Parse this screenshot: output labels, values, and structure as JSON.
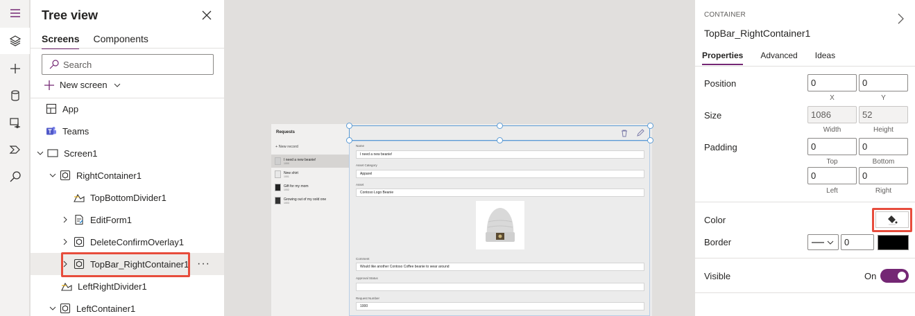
{
  "rail": {
    "items": [
      "hamburger-icon",
      "layers-icon",
      "plus-icon",
      "data-icon",
      "media-icon",
      "power-automate-icon",
      "search-icon"
    ]
  },
  "tree": {
    "title": "Tree view",
    "tabs": [
      {
        "label": "Screens",
        "active": true
      },
      {
        "label": "Components",
        "active": false
      }
    ],
    "search_placeholder": "Search",
    "new_screen": "New screen",
    "items": [
      {
        "label": "App",
        "icon": "app-icon"
      },
      {
        "label": "Teams",
        "icon": "teams-icon"
      },
      {
        "label": "Screen1",
        "icon": "screen-icon",
        "expanded": true
      },
      {
        "label": "RightContainer1",
        "icon": "container-icon",
        "expanded": true
      },
      {
        "label": "TopBottomDivider1",
        "icon": "divider-icon"
      },
      {
        "label": "EditForm1",
        "icon": "form-icon",
        "expanded": false
      },
      {
        "label": "DeleteConfirmOverlay1",
        "icon": "container-icon",
        "expanded": false
      },
      {
        "label": "TopBar_RightContainer1",
        "icon": "container-icon",
        "expanded": false,
        "selected": true
      },
      {
        "label": "LeftRightDivider1",
        "icon": "divider-icon"
      },
      {
        "label": "LeftContainer1",
        "icon": "container-icon",
        "expanded": true
      }
    ],
    "more": "···"
  },
  "app_preview": {
    "left_header": "Requests",
    "new_record": "New record",
    "requests": [
      {
        "title": "I need a new beanie!",
        "num": "1000"
      },
      {
        "title": "New shirt",
        "num": "1001"
      },
      {
        "title": "Gift for my mom",
        "num": "1002"
      },
      {
        "title": "Growing out of my oold one",
        "num": "1003"
      }
    ],
    "fields": [
      {
        "label": "Name",
        "value": "I need a new beanie!"
      },
      {
        "label": "Asset Category",
        "value": "Apparel"
      },
      {
        "label": "Asset",
        "value": "Contoso Logo Beanie"
      },
      {
        "label": "Comment",
        "value": "Would like another Contoso Coffee beanie to wear around"
      },
      {
        "label": "Approval Status",
        "value": ""
      },
      {
        "label": "Request Number",
        "value": "1000"
      }
    ]
  },
  "props": {
    "kind": "CONTAINER",
    "name": "TopBar_RightContainer1",
    "tabs": [
      {
        "label": "Properties",
        "active": true
      },
      {
        "label": "Advanced",
        "active": false
      },
      {
        "label": "Ideas",
        "active": false
      }
    ],
    "position": {
      "label": "Position",
      "x": "0",
      "y": "0",
      "x_label": "X",
      "y_label": "Y"
    },
    "size": {
      "label": "Size",
      "width": "1086",
      "height": "52",
      "width_label": "Width",
      "height_label": "Height"
    },
    "padding": {
      "label": "Padding",
      "top": "0",
      "bottom": "0",
      "left": "0",
      "right": "0",
      "top_label": "Top",
      "bottom_label": "Bottom",
      "left_label": "Left",
      "right_label": "Right"
    },
    "color": {
      "label": "Color"
    },
    "border": {
      "label": "Border",
      "width": "0",
      "color": "#000000"
    },
    "visible": {
      "label": "Visible",
      "state": "On"
    }
  },
  "colors": {
    "accent": "#742774",
    "highlight": "#e74c3c",
    "selection": "#5b9bd5"
  }
}
